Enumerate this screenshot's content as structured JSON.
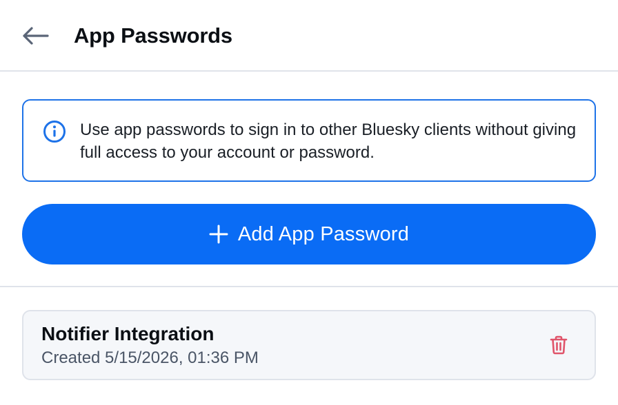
{
  "header": {
    "title": "App Passwords",
    "back_icon": "arrow-left-icon"
  },
  "info": {
    "icon": "info-circle-icon",
    "text": "Use app passwords to sign in to other Bluesky clients without giving full access to your account or password."
  },
  "add_button": {
    "icon": "plus-icon",
    "label": "Add App Password"
  },
  "app_passwords": [
    {
      "name": "Notifier Integration",
      "created": "Created 5/15/2026, 01:36 PM",
      "delete_icon": "trash-icon"
    }
  ],
  "colors": {
    "accent": "#0a6cf5",
    "info_border": "#1d72e8",
    "danger": "#e0546a",
    "divider": "#dfe3ea",
    "card_bg": "#f5f7fa"
  }
}
